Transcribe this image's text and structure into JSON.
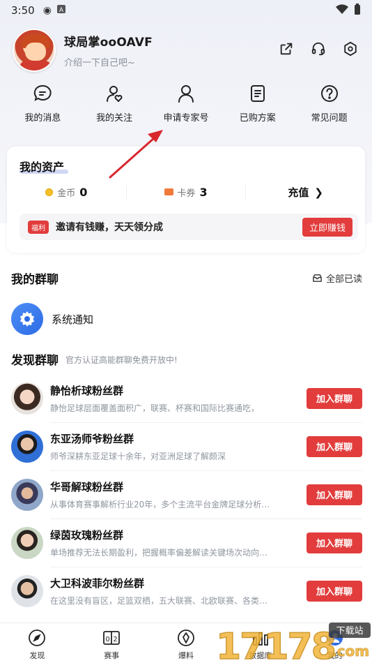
{
  "status_bar": {
    "time": "3:50"
  },
  "profile": {
    "username": "球局掌ooOAVF",
    "bio": "介绍一下自己吧~"
  },
  "quick_menu": [
    {
      "label": "我的消息",
      "icon": "message-icon"
    },
    {
      "label": "我的关注",
      "icon": "follow-icon"
    },
    {
      "label": "申请专家号",
      "icon": "expert-icon"
    },
    {
      "label": "已购方案",
      "icon": "purchased-icon"
    },
    {
      "label": "常见问题",
      "icon": "help-icon"
    }
  ],
  "assets": {
    "title": "我的资产",
    "coins_label": "金币",
    "coins_value": "0",
    "coupons_label": "卡券",
    "coupons_value": "3",
    "recharge_label": "充值",
    "promo_tag": "福利",
    "promo_text": "邀请有钱赚，天天领分成",
    "promo_button": "立即赚钱"
  },
  "my_groups": {
    "title": "我的群聊",
    "mark_all_read": "全部已读",
    "system_notice": "系统通知"
  },
  "discover": {
    "title": "发现群聊",
    "subtitle": "官方认证高能群聊免费开放中!",
    "join_label": "加入群聊",
    "groups": [
      {
        "name": "静怡析球粉丝群",
        "desc": "静怡足球层面覆盖面积广，联赛、杯赛和国际比赛通吃，"
      },
      {
        "name": "东亚汤师爷粉丝群",
        "desc": "师爷深耕东亚足球十余年，对亚洲足球了解颇深"
      },
      {
        "name": "华哥解球粉丝群",
        "desc": "从事体育赛事解析行业20年，多个主流平台金牌足球分析…"
      },
      {
        "name": "绿茵玫瑰粉丝群",
        "desc": "单场推荐无法长期盈利，把握概率偏差解读关键场次动向…"
      },
      {
        "name": "大卫科波菲尔粉丝群",
        "desc": "在这里没有盲区，足篮双栖，五大联赛、北欧联赛、各类…"
      }
    ]
  },
  "tab_bar": [
    {
      "label": "发现",
      "icon": "compass-icon"
    },
    {
      "label": "赛事",
      "icon": "scoreboard-icon"
    },
    {
      "label": "爆料",
      "icon": "tip-icon"
    },
    {
      "label": "数据库",
      "icon": "database-icon"
    },
    {
      "label": "我的",
      "icon": "profile-icon"
    }
  ],
  "watermark": {
    "brand": "17178",
    "sub": "下载站",
    "domain": ".com"
  },
  "colors": {
    "accent_red": "#e23c3c",
    "system_blue": "#2d6be4",
    "arrow_red": "#d8262d"
  }
}
